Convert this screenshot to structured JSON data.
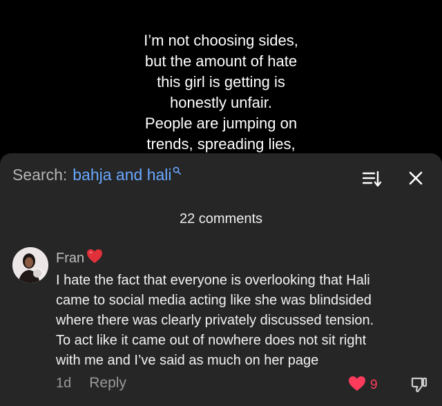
{
  "video": {
    "caption_lines": [
      "I’m not choosing sides,",
      "but the amount of hate",
      "this girl is getting is",
      "honestly unfair.",
      "People are jumping on",
      "trends, spreading lies,"
    ]
  },
  "comments_panel": {
    "search_prefix": "Search:",
    "search_term": "bahja and hali",
    "count_label": "22 comments",
    "icons": {
      "search": "search-icon",
      "sort": "sort-icon",
      "close": "close-icon"
    },
    "comments": [
      {
        "author": "Fran",
        "author_emoji": "❤️",
        "text_lines": [
          "I hate the fact that everyone is overlooking that Hali",
          "came to social media acting like she was blindsided",
          "where there was clearly privately discussed tension.",
          "To act like it came out of nowhere does not sit right",
          "with me and I’ve said as much on her page"
        ],
        "time": "1d",
        "reply_label": "Reply",
        "likes": "9"
      }
    ]
  },
  "colors": {
    "sheet_bg": "#262626",
    "search_term": "#69a8ff",
    "like": "#ff3b5c"
  }
}
